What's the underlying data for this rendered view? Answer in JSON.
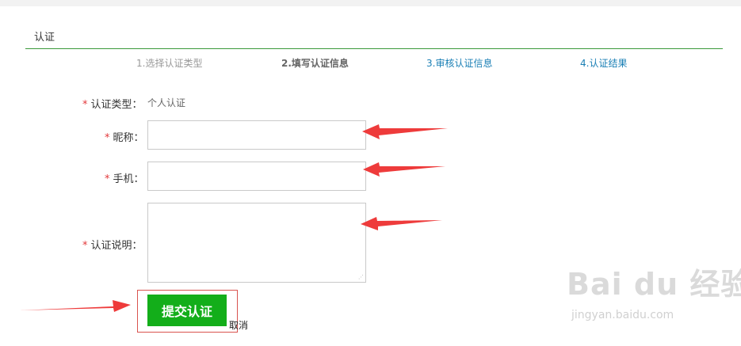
{
  "page": {
    "title": "认证"
  },
  "steps": [
    {
      "label": "1.选择认证类型",
      "state": "done"
    },
    {
      "label": "2.填写认证信息",
      "state": "current"
    },
    {
      "label": "3.审核认证信息",
      "state": "pending"
    },
    {
      "label": "4.认证结果",
      "state": "pending"
    }
  ],
  "form": {
    "required_mark": "*",
    "type_label": "认证类型：",
    "type_value": "个人认证",
    "nickname_label": "昵称：",
    "nickname_value": "",
    "phone_label": "手机：",
    "phone_value": "",
    "desc_label": "认证说明：",
    "desc_value": ""
  },
  "actions": {
    "submit_label": "提交认证",
    "cancel_label": "取消"
  },
  "watermark": {
    "brand": "Bai du 经验",
    "url": "jingyan.baidu.com"
  },
  "colors": {
    "accent_green": "#13ae1a",
    "step_link": "#1a7fb5",
    "required": "#e2383a",
    "arrow": "#ee3b3b"
  }
}
